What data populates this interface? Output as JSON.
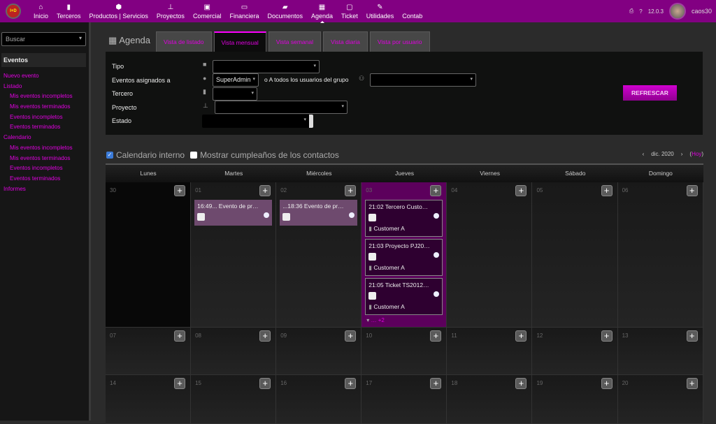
{
  "topbar": {
    "logo_text": "I+D WEB",
    "menu": [
      {
        "label": "Inicio",
        "icon": "home-icon",
        "glyph": "⌂"
      },
      {
        "label": "Terceros",
        "icon": "building-icon",
        "glyph": "▮"
      },
      {
        "label": "Productos | Servicios",
        "icon": "cube-icon",
        "glyph": "⬢"
      },
      {
        "label": "Proyectos",
        "icon": "sitemap-icon",
        "glyph": "⊥"
      },
      {
        "label": "Comercial",
        "icon": "briefcase-icon",
        "glyph": "▣"
      },
      {
        "label": "Financiera",
        "icon": "money-icon",
        "glyph": "▭"
      },
      {
        "label": "Documentos",
        "icon": "folder-open-icon",
        "glyph": "▰"
      },
      {
        "label": "Agenda",
        "icon": "calendar-icon",
        "glyph": "▦",
        "active": true
      },
      {
        "label": "Ticket",
        "icon": "ticket-icon",
        "glyph": "▢"
      },
      {
        "label": "Utilidades",
        "icon": "wrench-icon",
        "glyph": "✎"
      },
      {
        "label": "Contab",
        "icon": "",
        "glyph": ""
      }
    ],
    "version": "12.0.3",
    "username": "caos30"
  },
  "sidebar": {
    "search_placeholder": "Buscar",
    "section": "Eventos",
    "links": [
      {
        "label": "Nuevo evento",
        "sub": false
      },
      {
        "label": "Listado",
        "sub": false
      },
      {
        "label": "Mis eventos incompletos",
        "sub": true
      },
      {
        "label": "Mis eventos terminados",
        "sub": true
      },
      {
        "label": "Eventos incompletos",
        "sub": true
      },
      {
        "label": "Eventos terminados",
        "sub": true
      },
      {
        "label": "Calendario",
        "sub": false
      },
      {
        "label": "Mis eventos incompletos",
        "sub": true
      },
      {
        "label": "Mis eventos terminados",
        "sub": true
      },
      {
        "label": "Eventos incompletos",
        "sub": true
      },
      {
        "label": "Eventos terminados",
        "sub": true
      },
      {
        "label": "Informes",
        "sub": false
      }
    ]
  },
  "page": {
    "title": "Agenda",
    "tabs": [
      "Vista de listado",
      "Vista mensual",
      "Vista semanal",
      "Vista diaria",
      "Vista por usuario"
    ],
    "active_tab": 1
  },
  "filters": {
    "tipo": "Tipo",
    "asignados": "Eventos asignados a",
    "asignados_value": "SuperAdmin",
    "grupo_text": "o A todos los usuarios del grupo",
    "tercero": "Tercero",
    "proyecto": "Proyecto",
    "estado": "Estado",
    "refresh": "REFRESCAR"
  },
  "options": {
    "internal": "Calendario interno",
    "internal_checked": true,
    "birthdays": "Mostrar cumpleaños de los contactos",
    "birthdays_checked": false
  },
  "nav": {
    "month": "dic. 2020",
    "today": "Hoy"
  },
  "calendar": {
    "days": [
      "Lunes",
      "Martes",
      "Miércoles",
      "Jueves",
      "Viernes",
      "Sábado",
      "Domingo"
    ],
    "weeks": [
      [
        {
          "d": "30",
          "other": true
        },
        {
          "d": "01",
          "events": [
            {
              "t": "16:49... Evento de pr…"
            }
          ]
        },
        {
          "d": "02",
          "events": [
            {
              "t": "...18:36 Evento de pr…"
            }
          ]
        },
        {
          "d": "03",
          "today": true,
          "events": [
            {
              "t": "21:02 Tercero Custo…",
              "c": "Customer A"
            },
            {
              "t": "21:03 Proyecto PJ20…",
              "c": "Customer A"
            },
            {
              "t": "21:05 Ticket TS2012…",
              "c": "Customer A"
            }
          ],
          "more": "… +2"
        },
        {
          "d": "04"
        },
        {
          "d": "05"
        },
        {
          "d": "06"
        }
      ],
      [
        {
          "d": "07"
        },
        {
          "d": "08"
        },
        {
          "d": "09"
        },
        {
          "d": "10"
        },
        {
          "d": "11"
        },
        {
          "d": "12"
        },
        {
          "d": "13"
        }
      ],
      [
        {
          "d": "14"
        },
        {
          "d": "15"
        },
        {
          "d": "16"
        },
        {
          "d": "17"
        },
        {
          "d": "18"
        },
        {
          "d": "19"
        },
        {
          "d": "20"
        }
      ]
    ]
  }
}
